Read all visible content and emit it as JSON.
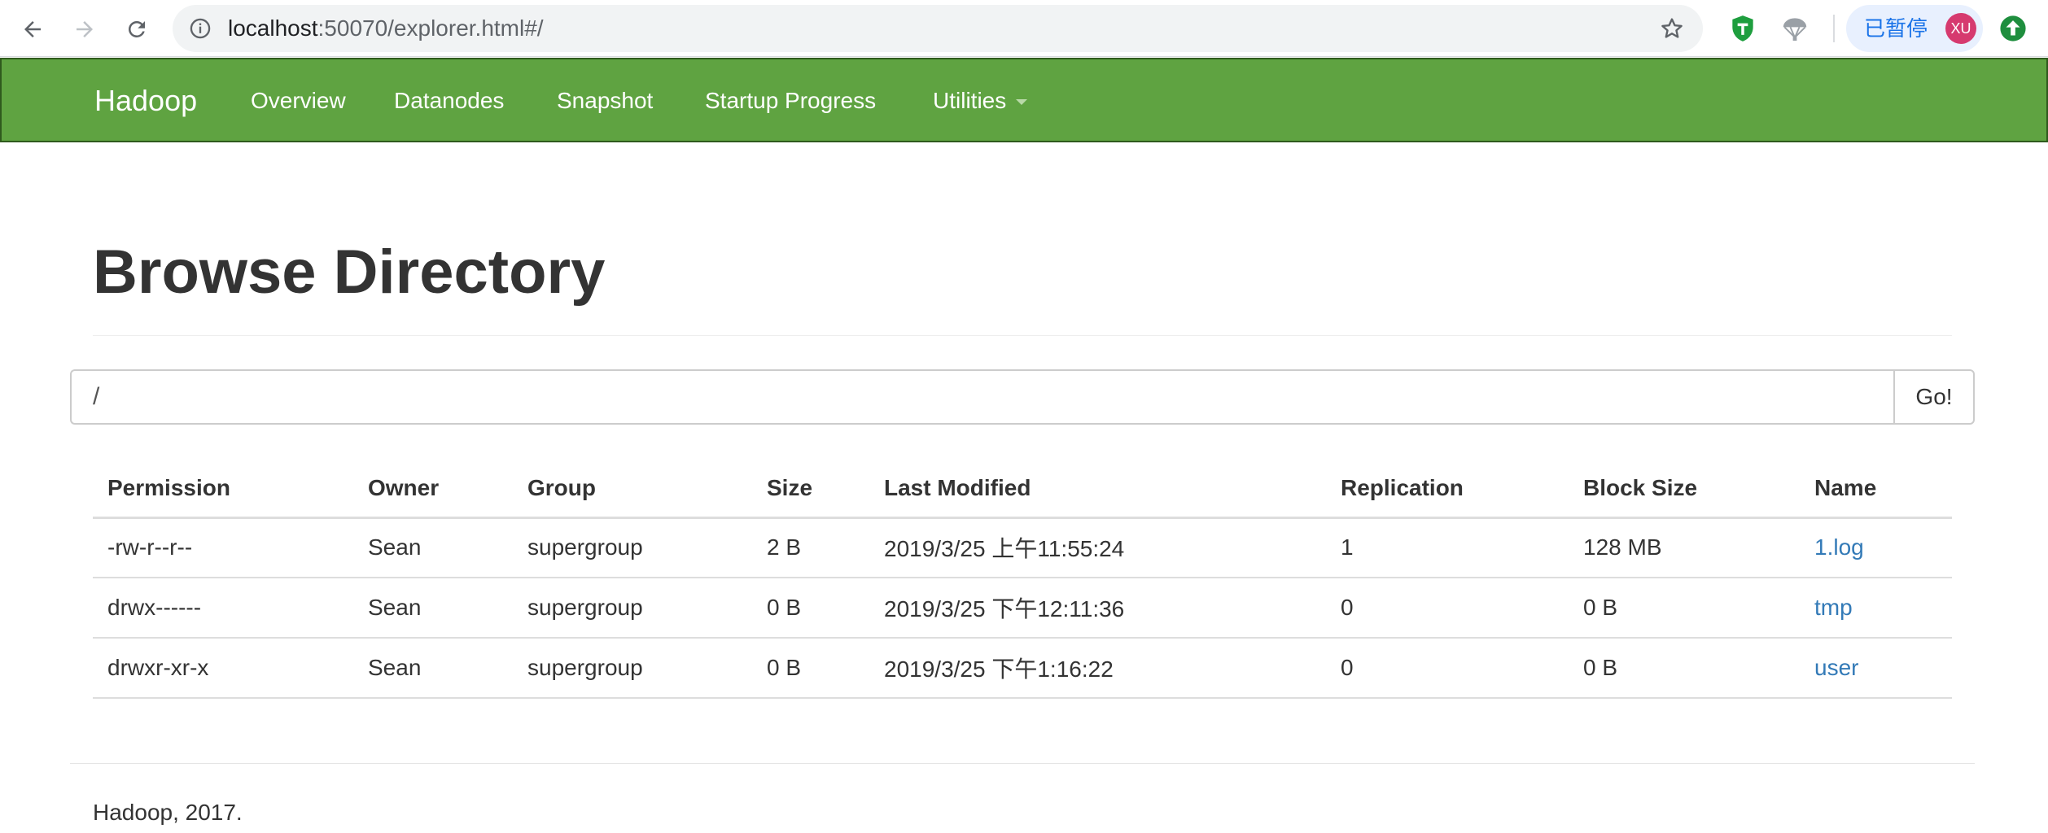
{
  "browser": {
    "url_host": "localhost",
    "url_rest": ":50070/explorer.html#/",
    "profile_status": "已暂停",
    "profile_initials": "XU",
    "accent": "#1a73e8"
  },
  "navbar": {
    "brand": "Hadoop",
    "items": [
      {
        "label": "Overview"
      },
      {
        "label": "Datanodes"
      },
      {
        "label": "Snapshot"
      },
      {
        "label": "Startup Progress"
      },
      {
        "label": "Utilities",
        "has_dropdown": true
      }
    ],
    "color": "#5fa341"
  },
  "page": {
    "title": "Browse Directory",
    "path_value": "/",
    "go_label": "Go!"
  },
  "table": {
    "headers": [
      "Permission",
      "Owner",
      "Group",
      "Size",
      "Last Modified",
      "Replication",
      "Block Size",
      "Name"
    ],
    "rows": [
      {
        "permission": "-rw-r--r--",
        "owner": "Sean",
        "group": "supergroup",
        "size": "2 B",
        "last_modified": "2019/3/25 上午11:55:24",
        "replication": "1",
        "block_size": "128 MB",
        "name": "1.log"
      },
      {
        "permission": "drwx------",
        "owner": "Sean",
        "group": "supergroup",
        "size": "0 B",
        "last_modified": "2019/3/25 下午12:11:36",
        "replication": "0",
        "block_size": "0 B",
        "name": "tmp"
      },
      {
        "permission": "drwxr-xr-x",
        "owner": "Sean",
        "group": "supergroup",
        "size": "0 B",
        "last_modified": "2019/3/25 下午1:16:22",
        "replication": "0",
        "block_size": "0 B",
        "name": "user"
      }
    ],
    "link_color": "#337ab7"
  },
  "footer": {
    "text": "Hadoop, 2017."
  }
}
